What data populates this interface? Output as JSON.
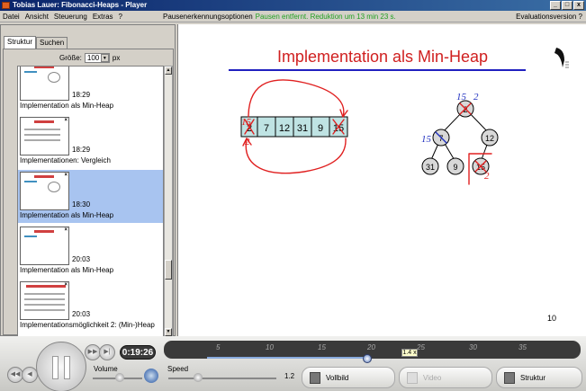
{
  "window": {
    "title": "Tobias Lauer: Fibonacci-Heaps - Player",
    "buttons": [
      "_",
      "□",
      "x"
    ]
  },
  "menubar": {
    "items": [
      "Datei",
      "Ansicht",
      "Steuerung",
      "Extras",
      "?"
    ],
    "pause_label": "Pausenerkennungsoptionen",
    "pause_status": "Pausen entfernt. Reduktion um 13 min 23 s.",
    "eval_label": "Evaluationsversion",
    "eval_help": "?"
  },
  "sidebar": {
    "tabs": [
      "Struktur",
      "Suchen"
    ],
    "size_label": "Größe:",
    "size_value": "100",
    "size_unit": "px",
    "items": [
      {
        "time": "18:29",
        "title": "Implementation als Min-Heap"
      },
      {
        "time": "18:29",
        "title": "Implementationen: Vergleich"
      },
      {
        "time": "18:30",
        "title": "Implementation als Min-Heap"
      },
      {
        "time": "20:03",
        "title": "Implementation als Min-Heap"
      },
      {
        "time": "20:03",
        "title": "Implementationsmöglichkeit 2: (Min-)Heap"
      }
    ]
  },
  "slide": {
    "title": "Implementation als Min-Heap",
    "array_cells": [
      "2",
      "7",
      "12",
      "31",
      "9",
      "15"
    ],
    "tree_nodes": [
      "2",
      "7",
      "12",
      "31",
      "9",
      "15"
    ],
    "annotations": [
      "15",
      "2",
      "15",
      "2",
      "15",
      "2"
    ],
    "page_number": "10"
  },
  "controls": {
    "time": "0:19:26",
    "timeline_ticks": [
      "5",
      "10",
      "15",
      "20",
      "25",
      "30",
      "35"
    ],
    "speed_badge": "1.4 x",
    "volume_label": "Volume",
    "speed_label": "Speed",
    "speed_value": "1.2",
    "views": [
      {
        "label": "Vollbild",
        "enabled": true
      },
      {
        "label": "Video",
        "enabled": false
      },
      {
        "label": "Struktur",
        "enabled": true
      }
    ]
  },
  "colors": {
    "title_red": "#d02020",
    "rule_blue": "#2020c0",
    "ink_red": "#e02020",
    "ink_blue": "#2030c0",
    "selection": "#a8c4f0",
    "status_green": "#22a022"
  }
}
